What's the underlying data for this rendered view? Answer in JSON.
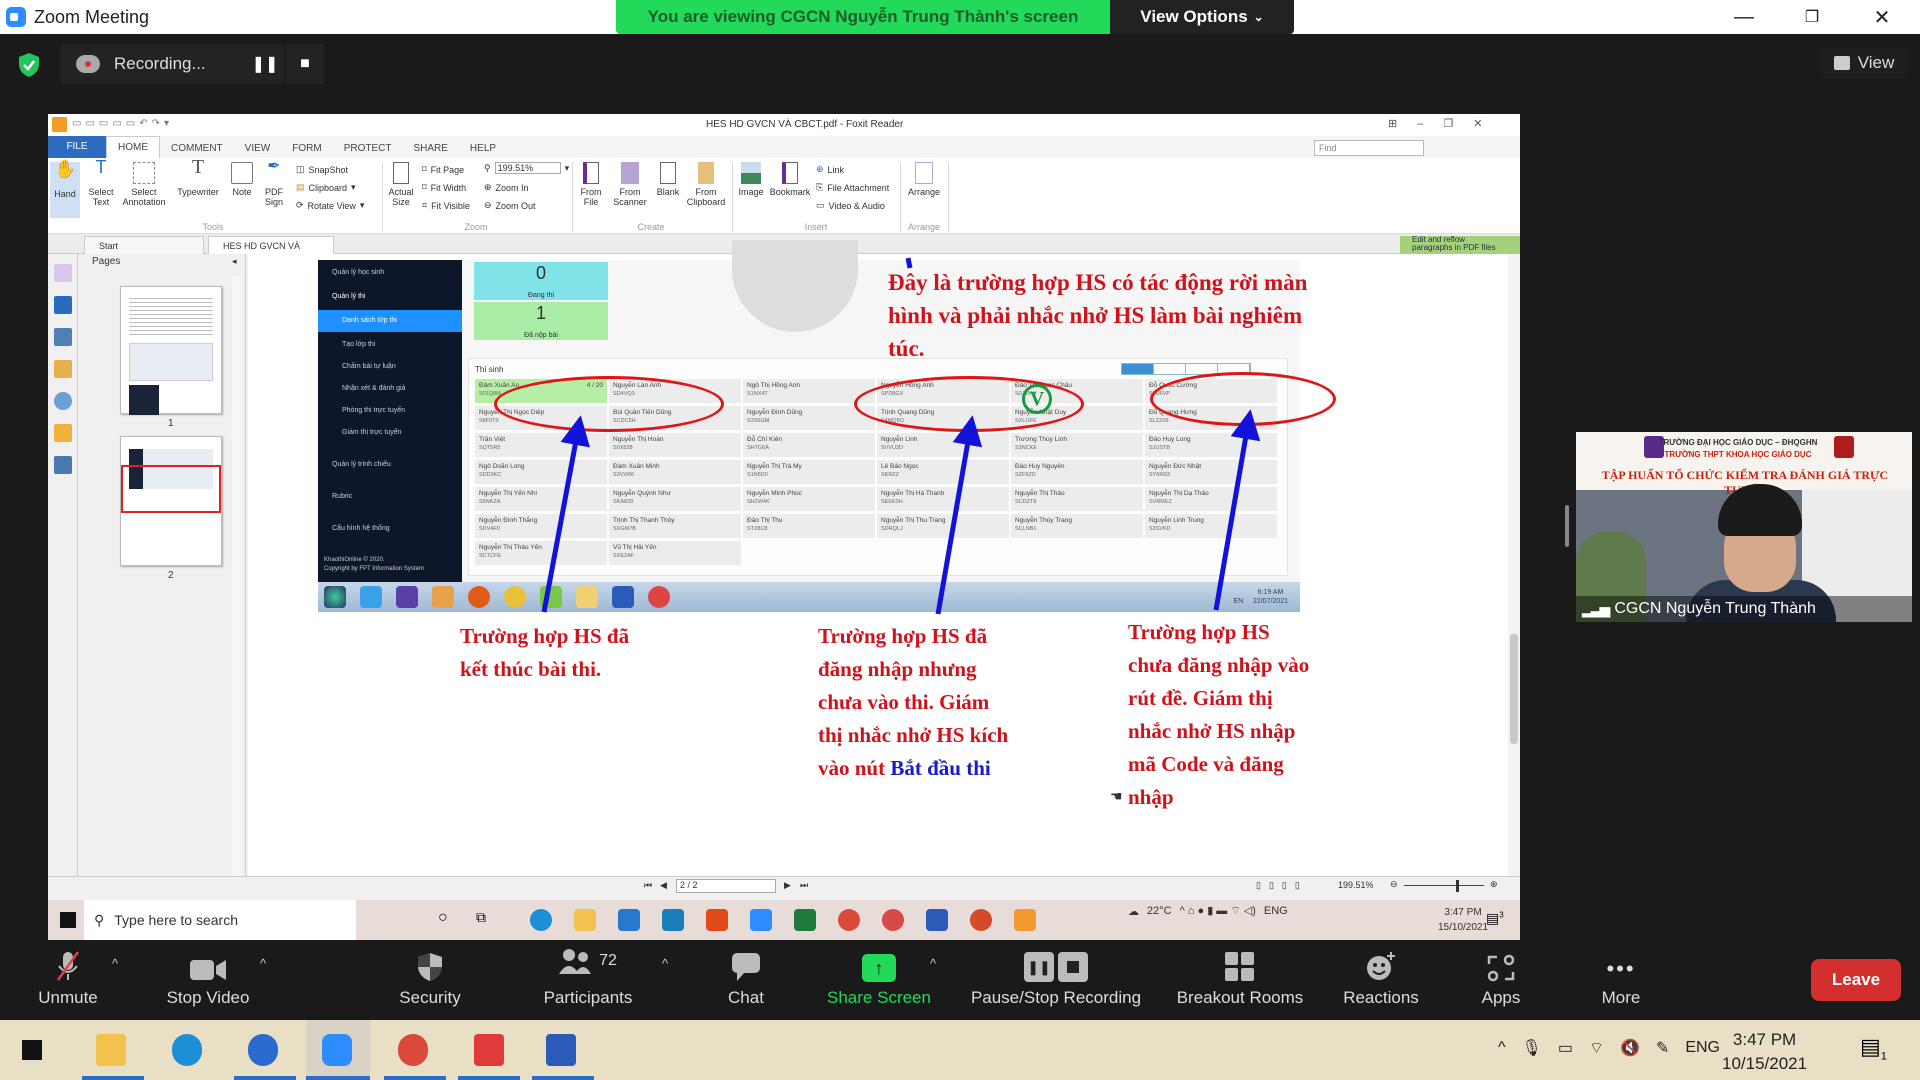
{
  "window": {
    "title": "Zoom Meeting",
    "viewing_banner": "You are viewing CGCN Nguyễn Trung Thành's screen",
    "view_options": "View Options",
    "view_options_icon": "chevron-down-icon",
    "view_label": "View"
  },
  "recording": {
    "label": "Recording...",
    "pause_icon": "pause-icon",
    "stop_icon": "stop-icon"
  },
  "foxit": {
    "title": "HES HD GVCN VÀ CBCT.pdf - Foxit Reader",
    "menu": [
      "FILE",
      "HOME",
      "COMMENT",
      "VIEW",
      "FORM",
      "PROTECT",
      "SHARE",
      "HELP"
    ],
    "tools": {
      "hand": "Hand",
      "select_text": "Select\nText",
      "select_annotation": "Select\nAnnotation",
      "typewriter": "Typewriter",
      "note": "Note",
      "pdf_sign": "PDF\nSign",
      "snapshot": "SnapShot",
      "clipboard": "Clipboard",
      "rotate_view": "Rotate View",
      "group": "Tools"
    },
    "zoom_group": {
      "actual_size": "Actual\nSize",
      "fit_page": "Fit Page",
      "fit_width": "Fit Width",
      "fit_visible": "Fit Visible",
      "zoom_value": "199.51%",
      "zoom_in": "Zoom In",
      "zoom_out": "Zoom Out",
      "group": "Zoom"
    },
    "create_group": {
      "from_file": "From\nFile",
      "from_scanner": "From\nScanner",
      "blank": "Blank",
      "from_clipboard": "From\nClipboard",
      "group": "Create"
    },
    "insert_group": {
      "image": "Image",
      "bookmark": "Bookmark",
      "link": "Link",
      "file_attachment": "File Attachment",
      "video_audio": "Video & Audio",
      "group": "Insert"
    },
    "arrange_group": {
      "arrange": "Arrange",
      "group": "Arrange"
    },
    "find_placeholder": "Find",
    "tabs": [
      "Start",
      "HES HD GVCN VÀ CB..."
    ],
    "reflow_banner": "Edit and reflow\nparagraphs in PDF files",
    "pages_label": "Pages",
    "page_numbers": [
      "1",
      "2"
    ],
    "status": {
      "page": "2 / 2",
      "zoom": "199.51%"
    }
  },
  "slide": {
    "top_note": "Đây là trường hợp HS có tác động rời màn hình và phải nhắc nhở HS làm bài nghiêm túc.",
    "note_left": "Trường hợp HS đã\nkết thúc bài thi.",
    "note_middle_pre": "Trường hợp HS đã\nđăng nhập nhưng\nchưa vào thi. Giám\nthị nhắc nhở HS kích\nvào nút ",
    "note_middle_link": "Bắt đầu thi",
    "note_right": "Trường hợp HS\nchưa đăng nhập vào\nrút đề. Giám thị\nnhắc nhở HS nhập\nmã Code và đăng\nnhập",
    "check_mark": "V"
  },
  "exam_app": {
    "sidebar": [
      {
        "label": "Quản lý học sinh"
      },
      {
        "label": "Quản lý thi"
      },
      {
        "label": "Danh sách lớp thi",
        "active": true
      },
      {
        "label": "Tạo lớp thi"
      },
      {
        "label": "Chấm bài tự luận"
      },
      {
        "label": "Nhận xét & đánh giá"
      },
      {
        "label": "Phòng thi trực tuyến"
      },
      {
        "label": "Giám thị trực tuyến"
      },
      {
        "label": "Quản lý trình chiếu"
      },
      {
        "label": "Rubric"
      },
      {
        "label": "Cấu hình hệ thống"
      }
    ],
    "copyright": "KhaothiOnline © 2020.\nCopyright by FPT Information System",
    "stats": [
      {
        "value": "0",
        "label": "Đang thi"
      },
      {
        "value": "1",
        "label": "Đã nộp bài"
      }
    ],
    "table_title": "Thí sinh",
    "students": [
      [
        {
          "name": "Đàm Xuân An",
          "code": "S01Q8M",
          "score": "4 / 20"
        },
        {
          "name": "Nguyễn Lan Anh",
          "code": "SD4VQ3"
        },
        {
          "name": "Ngô Thị Hồng Anh",
          "code": "S1NX4T"
        },
        {
          "name": "Nguyễn Hồng Anh",
          "code": "SPD8GX"
        },
        {
          "name": "Đào Thị Ngọc Châu",
          "code": "S0J8XW"
        },
        {
          "name": "Đỗ Quốc Cường",
          "code": "S0U6VP"
        }
      ],
      [
        {
          "name": "Nguyễn Thị Ngọc Diệp",
          "code": "S8F5T0"
        },
        {
          "name": "Bùi Quân Tiến Dũng",
          "code": "SCDC5H"
        },
        {
          "name": "Nguyễn Đình Dũng",
          "code": "S3S6GM"
        },
        {
          "name": "Trịnh Quang Dũng",
          "code": "S4MQ5O"
        },
        {
          "name": "Nguyễn Nhật Duy",
          "code": "SXLGFE"
        },
        {
          "name": "Đỗ Quang Hưng",
          "code": "SLZZ06"
        }
      ],
      [
        {
          "name": "Trần Việt",
          "code": "SQT5R5"
        },
        {
          "name": "Nguyễn Thị Hoàn",
          "code": "S0X828"
        },
        {
          "name": "Đỗ Chí Kiên",
          "code": "SHTG6A"
        },
        {
          "name": "Nguyễn Linh",
          "code": "SVVU3D"
        },
        {
          "name": "Trương Thùy Linh",
          "code": "S3NCKE"
        },
        {
          "name": "Đào Huy Long",
          "code": "SJUSTB"
        }
      ],
      [
        {
          "name": "Ngô Doãn Long",
          "code": "SDD3KC"
        },
        {
          "name": "Đàm Xuân Minh",
          "code": "S3VVR6"
        },
        {
          "name": "Nguyễn Thị Trà My",
          "code": "S1N5D0"
        },
        {
          "name": "Lê Bảo Ngọc",
          "code": "SKRZZ"
        },
        {
          "name": "Đào Huy Nguyên",
          "code": "SZF6ZD"
        },
        {
          "name": "Nguyễn Đức Nhật",
          "code": "SYKR63"
        }
      ],
      [
        {
          "name": "Nguyễn Thị Yến Nhi",
          "code": "S5NKZA"
        },
        {
          "name": "Nguyễn Quỳnh Như",
          "code": "SKA828"
        },
        {
          "name": "Nguyễn Minh Phúc",
          "code": "SH2W4K"
        },
        {
          "name": "Nguyễn Thị Hà Thanh",
          "code": "SEEK3H"
        },
        {
          "name": "Nguyễn Thị Thảo",
          "code": "SCDZT8"
        },
        {
          "name": "Nguyễn Thị Dạ Thảo",
          "code": "SVRMEZ"
        }
      ],
      [
        {
          "name": "Nguyễn Đình Thắng",
          "code": "SDV4F0"
        },
        {
          "name": "Trịnh Thị Thanh Thủy",
          "code": "SXGM7B"
        },
        {
          "name": "Đào Thị Thu",
          "code": "STZ8C8"
        },
        {
          "name": "Nguyễn Thị Thu Trang",
          "code": "SDRQLJ"
        },
        {
          "name": "Nguyễn Thùy Trang",
          "code": "SCLNB1"
        },
        {
          "name": "Nguyễn Linh Trung",
          "code": "S3SVKD"
        }
      ],
      [
        {
          "name": "Nguyễn Thị Thảo Yến",
          "code": "SCTCFE"
        },
        {
          "name": "Vũ Thị Hải Yến",
          "code": "SXE2AF"
        }
      ]
    ],
    "win7_tray": {
      "lang": "EN",
      "time": "6:19 AM",
      "date": "22/07/2021"
    }
  },
  "remote_taskbar": {
    "search_placeholder": "Type here to search",
    "weather": "22°C",
    "lang": "ENG",
    "time": "3:47 PM",
    "date": "15/10/2021",
    "notif_count": "3"
  },
  "video": {
    "banner_line1": "TRƯỜNG ĐẠI HỌC GIÁO DỤC – ĐHQGHN",
    "banner_line2": "TRƯỜNG THPT KHOA HỌC GIÁO DỤC",
    "banner_line3": "TẬP HUẤN TỔ CHỨC KIỂM TRA ĐÁNH GIÁ TRỰC TUYẾN",
    "participant_name": "CGCN Nguyễn Trung Thành"
  },
  "controls": {
    "unmute": "Unmute",
    "stop_video": "Stop Video",
    "security": "Security",
    "participants": "Participants",
    "participants_count": "72",
    "chat": "Chat",
    "share_screen": "Share Screen",
    "pause_stop_recording": "Pause/Stop Recording",
    "breakout_rooms": "Breakout Rooms",
    "reactions": "Reactions",
    "apps": "Apps",
    "more": "More",
    "leave": "Leave",
    "share_color": "#23d959",
    "leave_color": "#d32f2f"
  },
  "host_taskbar": {
    "lang": "ENG",
    "time": "3:47 PM",
    "date": "10/15/2021",
    "notif_count": "1"
  }
}
